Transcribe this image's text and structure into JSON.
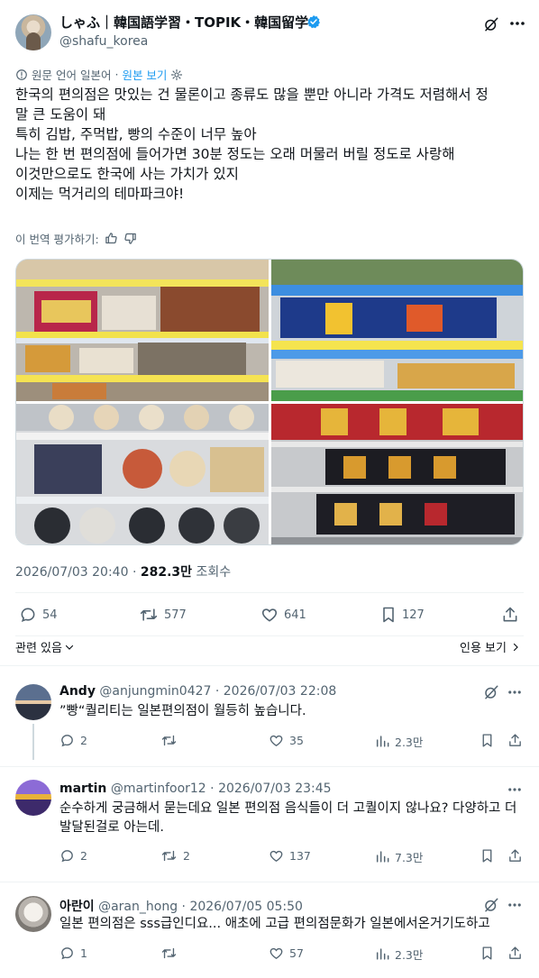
{
  "main": {
    "display_name": "しゃふ｜韓国語学習・TOPIK・韓国留学",
    "handle": "@shafu_korea",
    "translated_from": "원문 언어 일본어",
    "show_original": "원본 보기",
    "text_lines": [
      "한국의 편의점은 맛있는 건 물론이고 종류도 많을 뿐만 아니라 가격도 저렴해서 정",
      "말 큰 도움이 돼",
      "특히 김밥, 주먹밥, 빵의 수준이 너무 높아",
      "나는 한 번 편의점에 들어가면 30분 정도는 오래 머물러 버릴 정도로 사랑해",
      "이것만으로도 한국에 사는 가치가 있지",
      "이제는 먹거리의 테마파크야!"
    ],
    "rate_translation": "이 번역 평가하기:",
    "timestamp": "2026/07/03 20:40",
    "separator": "·",
    "views_count": "282.3만",
    "views_label": "조회수",
    "replies": "54",
    "reposts": "577",
    "likes": "641",
    "bookmarks": "127",
    "related_label": "관련 있음",
    "quote_view_label": "인용 보기"
  },
  "replies": [
    {
      "name": "Andy",
      "handle": "@anjungmin0427",
      "time": "· 2026/07/03 22:08",
      "text_lines": [
        "”빵“퀄리티는 일본편의점이 월등히 높습니다."
      ],
      "replies": "2",
      "reposts": "",
      "likes": "35",
      "views": "2.3만"
    },
    {
      "name": "martin",
      "handle": "@martinfoor12",
      "time": "· 2026/07/03 23:45",
      "text_lines": [
        "순수하게 궁금해서 묻는데요 일본 편의점 음식들이 더 고퀄이지 않나요? 다양하고 더",
        "발달된걸로 아는데."
      ],
      "replies": "2",
      "reposts": "2",
      "likes": "137",
      "views": "7.3만"
    },
    {
      "name": "아란이",
      "handle": "@aran_hong",
      "time": "· 2026/07/05 05:50",
      "text_lines": [
        "일본 편의점은 sss급인디요... 애초에 고급 편의점문화가 일본에서온거기도하고"
      ],
      "replies": "1",
      "reposts": "",
      "likes": "57",
      "views": "2.3만"
    }
  ],
  "photo_labels": [
    "TOP LEFT",
    "TOP RIGHT",
    "BOTTOM LEFT",
    "BOTTOM RIGHT"
  ],
  "colors": {
    "accent": "#1d9bf0",
    "muted": "#536471",
    "divider": "#eff3f4"
  }
}
